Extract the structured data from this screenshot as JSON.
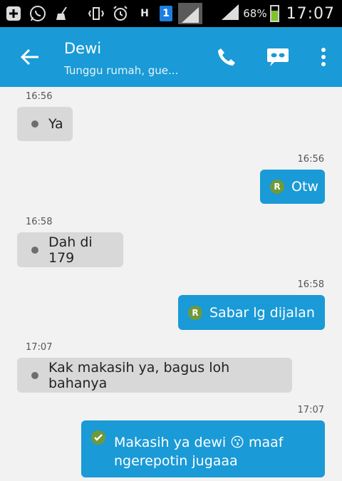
{
  "status_bar": {
    "icons": [
      "add-notification-icon",
      "whatsapp-icon",
      "cleaner-icon",
      "vibrate-icon",
      "alarm-icon",
      "h-data-icon",
      "sim-1-icon",
      "signal-box-icon",
      "signal-icon",
      "battery-icon"
    ],
    "data_type": "H",
    "sim_slot": "1",
    "battery_percent": "68%",
    "battery_level": 0.68,
    "time": "17:07"
  },
  "header": {
    "contact_name": "Dewi",
    "subtitle": "Tunggu rumah, gue...",
    "icons": [
      "back-arrow-icon",
      "phone-icon",
      "mask-icon",
      "more-vertical-icon"
    ]
  },
  "messages": [
    {
      "direction": "in",
      "time": "16:56",
      "text": "Ya"
    },
    {
      "direction": "out",
      "time": "16:56",
      "text": "Otw",
      "badge": "R"
    },
    {
      "direction": "in",
      "time": "16:58",
      "text": "Dah di 179"
    },
    {
      "direction": "out",
      "time": "16:58",
      "text": "Sabar lg dijalan",
      "badge": "R"
    },
    {
      "direction": "in",
      "time": "17:07",
      "text": "Kak makasih ya, bagus loh bahanya"
    },
    {
      "direction": "out",
      "time": "17:07",
      "text_line1": "Makasih ya dewi",
      "emoji": "😗",
      "text_line1_end": "maaf",
      "text_line2": "ngerepotin jugaaa",
      "badge_icon": "check-icon"
    }
  ],
  "colors": {
    "header_bg": "#1a9ad6",
    "outgoing_bubble": "#1a9ad6",
    "incoming_bubble": "#d8d8d8",
    "badge_green": "#6f9a3a",
    "background": "#f2f2f2"
  }
}
